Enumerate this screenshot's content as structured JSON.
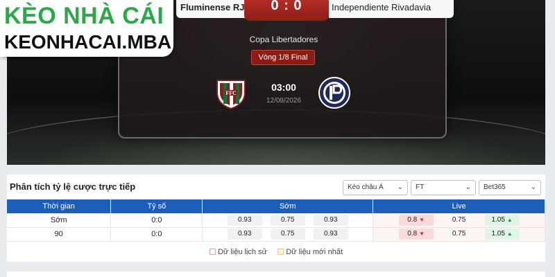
{
  "logo": {
    "line1": "KÈO NHÀ CÁI",
    "line2": "KEONHACAI.MBA"
  },
  "match": {
    "home_team": "Fluminense RJ",
    "away_team": "Independiente Rivadavia",
    "score": "0 : 0",
    "competition": "Copa Libertadores",
    "round": "Vòng 1/8 Final",
    "time": "03:00",
    "date": "12/08/2026"
  },
  "odds": {
    "title": "Phân tích tỷ lệ cược trực tiếp",
    "filters": [
      {
        "label": "Kèo châu Á"
      },
      {
        "label": "FT"
      },
      {
        "label": "Bet365"
      }
    ],
    "columns": {
      "time": "Thời gian",
      "score": "Tỷ số",
      "early": "Sớm",
      "live": "Live"
    },
    "rows": [
      {
        "time": "Sớm",
        "score": "0:0",
        "early": [
          "0.93",
          "0.75",
          "0.93"
        ],
        "live": [
          "0.8",
          "0.75",
          "1.05"
        ]
      },
      {
        "time": "90",
        "score": "0:0",
        "early": [
          "0.93",
          "0.75",
          "0.93"
        ],
        "live": [
          "0.8",
          "0.75",
          "1.05"
        ]
      }
    ],
    "legend": {
      "history": "Dữ liệu lịch sử",
      "latest": "Dữ liệu mới nhất"
    },
    "colors": {
      "header": "#1d5fb8",
      "down": "#d22222",
      "up": "#1a9a40"
    }
  }
}
